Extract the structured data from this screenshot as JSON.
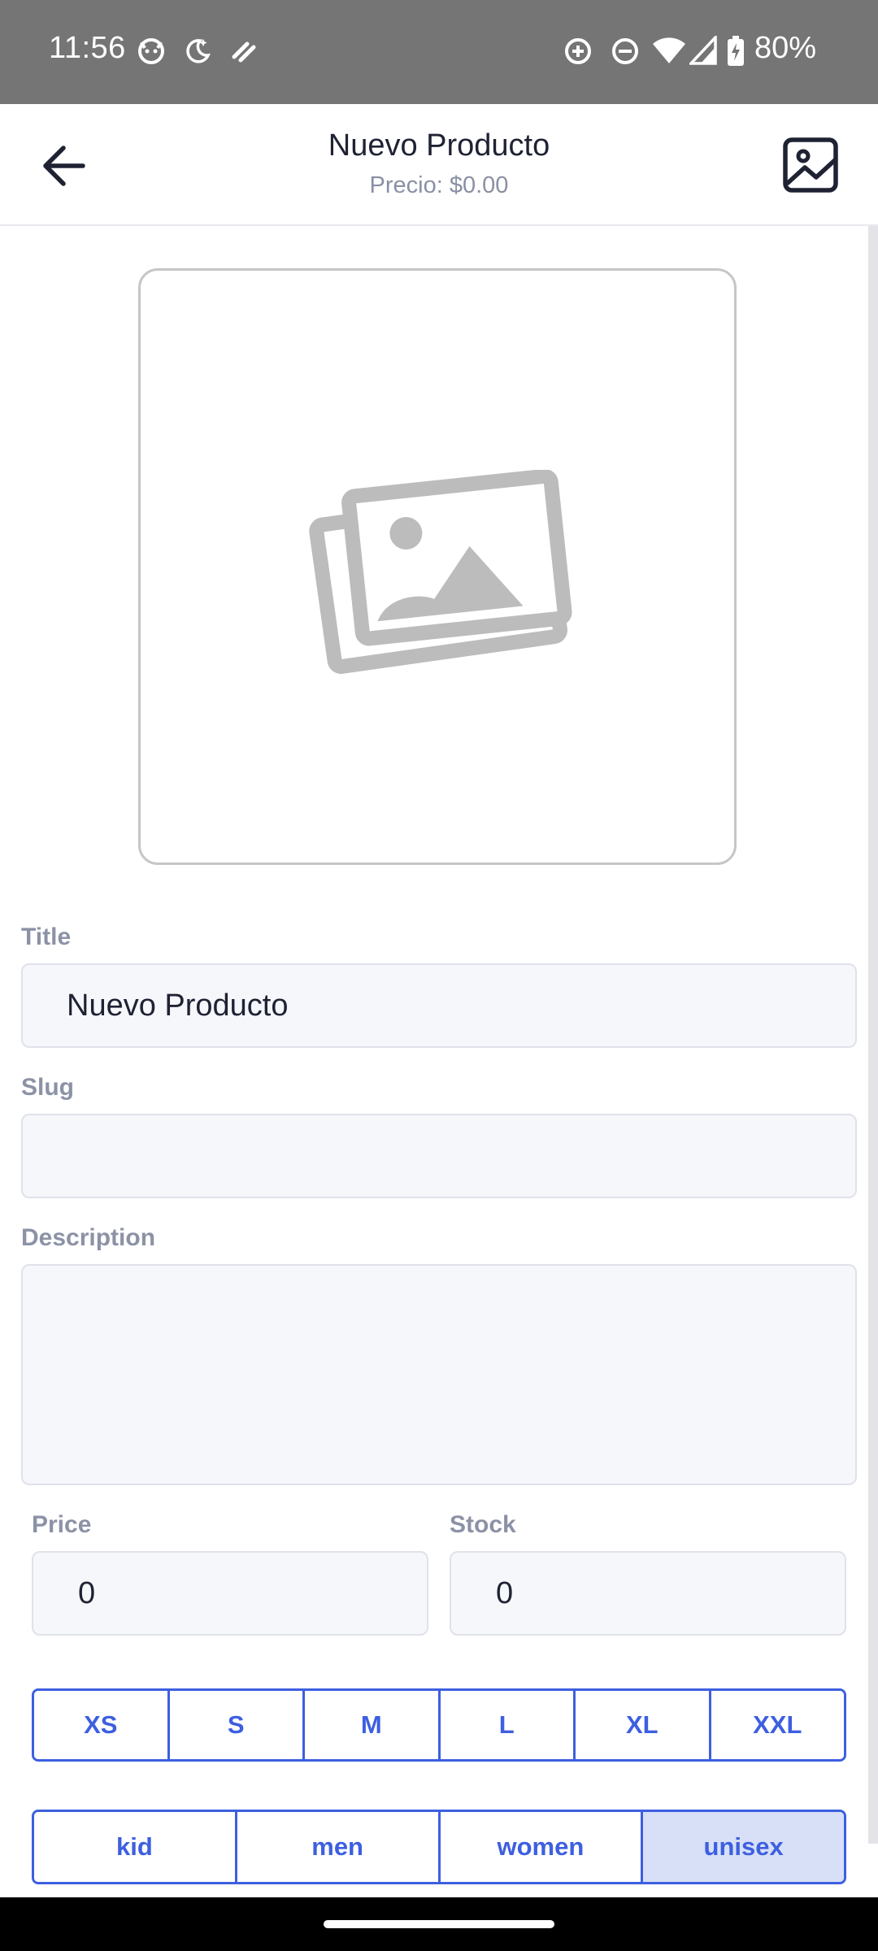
{
  "status_bar": {
    "time": "11:56",
    "battery": "80%",
    "icons": [
      "cat-face-icon",
      "moon-stars-icon",
      "link-icon",
      "data-saver-icon",
      "do-not-disturb-icon",
      "wifi-icon",
      "cell-signal-icon",
      "battery-charging-icon"
    ]
  },
  "app_bar": {
    "title": "Nuevo Producto",
    "subtitle": "Precio: $0.00",
    "back_icon": "arrow-left-icon",
    "action_icon": "image-icon"
  },
  "image_placeholder": {
    "icon": "images-placeholder-icon"
  },
  "form": {
    "title_label": "Title",
    "title_value": "Nuevo Producto",
    "slug_label": "Slug",
    "slug_value": "",
    "description_label": "Description",
    "description_value": "",
    "price_label": "Price",
    "price_value": "0",
    "stock_label": "Stock",
    "stock_value": "0"
  },
  "sizes": {
    "options": [
      "XS",
      "S",
      "M",
      "L",
      "XL",
      "XXL"
    ],
    "selected": []
  },
  "genders": {
    "options": [
      "kid",
      "men",
      "women",
      "unisex"
    ],
    "selected": "unisex"
  },
  "colors": {
    "accent": "#3d5fe0",
    "selected_bg": "#d8e0f8",
    "status_bar_bg": "#757575"
  }
}
